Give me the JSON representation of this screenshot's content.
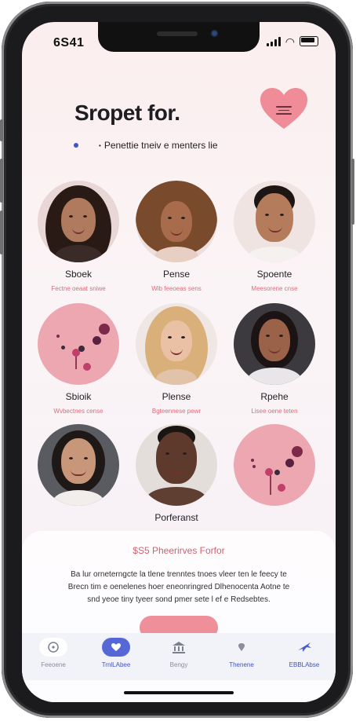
{
  "status_bar": {
    "time": "6S41"
  },
  "header": {
    "title": "Sropet for.",
    "subtitle_small": "•",
    "subtitle": "Penettie tneiv e menters lie"
  },
  "profiles": [
    {
      "name": "Sboek",
      "meta": "Fectne oeaat sniwe"
    },
    {
      "name": "Pense",
      "meta": "Wib feeoeas sens"
    },
    {
      "name": "Spoente",
      "meta": "Meesorene cnse"
    },
    {
      "name": "Sbioik",
      "meta": "Wvbectnes cense"
    },
    {
      "name": "Plense",
      "meta": "Bgteennese pewr"
    },
    {
      "name": "Rpehe",
      "meta": "Lisee oene teten"
    },
    {
      "name": "",
      "meta": ""
    },
    {
      "name": "Porferanst",
      "meta": ""
    },
    {
      "name": "",
      "meta": ""
    }
  ],
  "panel": {
    "title": "$S5 Pheerirves Forfor",
    "text": "Ba lur orneterngcte la tlene trenntes tnoes vleer ten le feecy te Brecn tim e oenelenes hoer eneonringred Dlhenocenta Aotne te snd yeoe tiny tyeer sond pmer sete l ef e Redsebtes."
  },
  "tabs": [
    {
      "label": "Feeoene",
      "icon": "compass-icon",
      "active": false
    },
    {
      "label": "TrnlLAbee",
      "icon": "heart-icon",
      "active": true
    },
    {
      "label": "Bengy",
      "icon": "building-icon",
      "active": false
    },
    {
      "label": "Thenene",
      "icon": "pin-icon",
      "active": false
    },
    {
      "label": "EBBLAbse",
      "icon": "plane-icon",
      "active": false
    }
  ],
  "colors": {
    "accent": "#ef8f9a",
    "heart": "#f08b98",
    "tab_active": "#5667d6",
    "meta_text": "#e06a7a"
  }
}
